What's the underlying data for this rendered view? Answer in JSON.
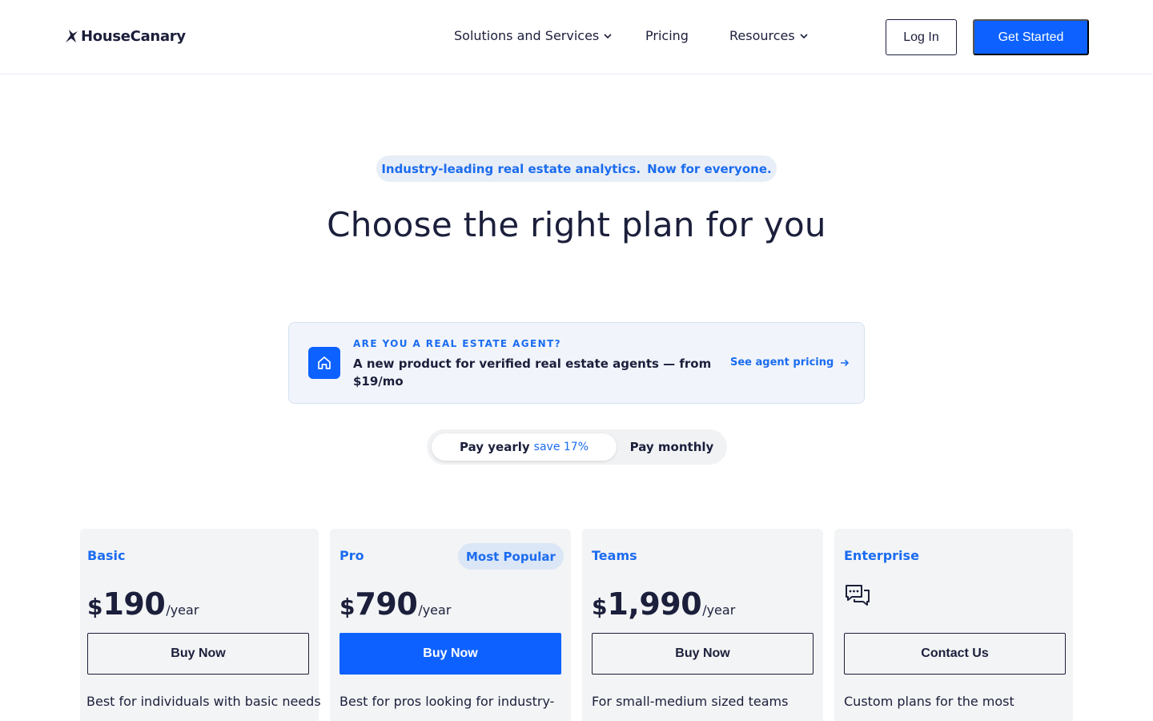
{
  "header": {
    "logo_text": "HouseCanary",
    "nav": [
      {
        "label": "Solutions and Services",
        "has_dropdown": true
      },
      {
        "label": "Pricing",
        "has_dropdown": false
      },
      {
        "label": "Resources",
        "has_dropdown": true
      }
    ],
    "login_label": "Log In",
    "get_started_label": "Get Started"
  },
  "hero": {
    "pill_part1": "Industry-leading real estate analytics.",
    "pill_part2": "Now for everyone.",
    "title": "Choose the right plan for you"
  },
  "agent_banner": {
    "eyebrow": "ARE YOU A REAL ESTATE AGENT?",
    "text": "A new product for verified real estate agents — from $19/mo",
    "link_label": "See agent pricing",
    "icon": "home-icon"
  },
  "billing_toggle": {
    "yearly_label": "Pay yearly",
    "yearly_save": "save 17%",
    "monthly_label": "Pay monthly",
    "selected": "yearly"
  },
  "plans": [
    {
      "name": "Basic",
      "currency": "$",
      "amount": "190",
      "period": "/year",
      "button": "Buy Now",
      "primary": false,
      "description": "Best for individuals with basic needs"
    },
    {
      "name": "Pro",
      "badge": "Most Popular",
      "currency": "$",
      "amount": "790",
      "period": "/year",
      "button": "Buy Now",
      "primary": true,
      "description": "Best for pros looking for industry-"
    },
    {
      "name": "Teams",
      "currency": "$",
      "amount": "1,990",
      "period": "/year",
      "button": "Buy Now",
      "primary": false,
      "description": "For small-medium sized teams"
    },
    {
      "name": "Enterprise",
      "icon": "chat-bubbles-icon",
      "button": "Contact Us",
      "primary": false,
      "description": "Custom plans for the most"
    }
  ],
  "colors": {
    "brand_blue": "#0d62ff",
    "link_blue": "#1b6cf0",
    "text_dark": "#1b1f3b",
    "card_bg": "#f3f4f5",
    "banner_bg": "#f1f5fb"
  }
}
